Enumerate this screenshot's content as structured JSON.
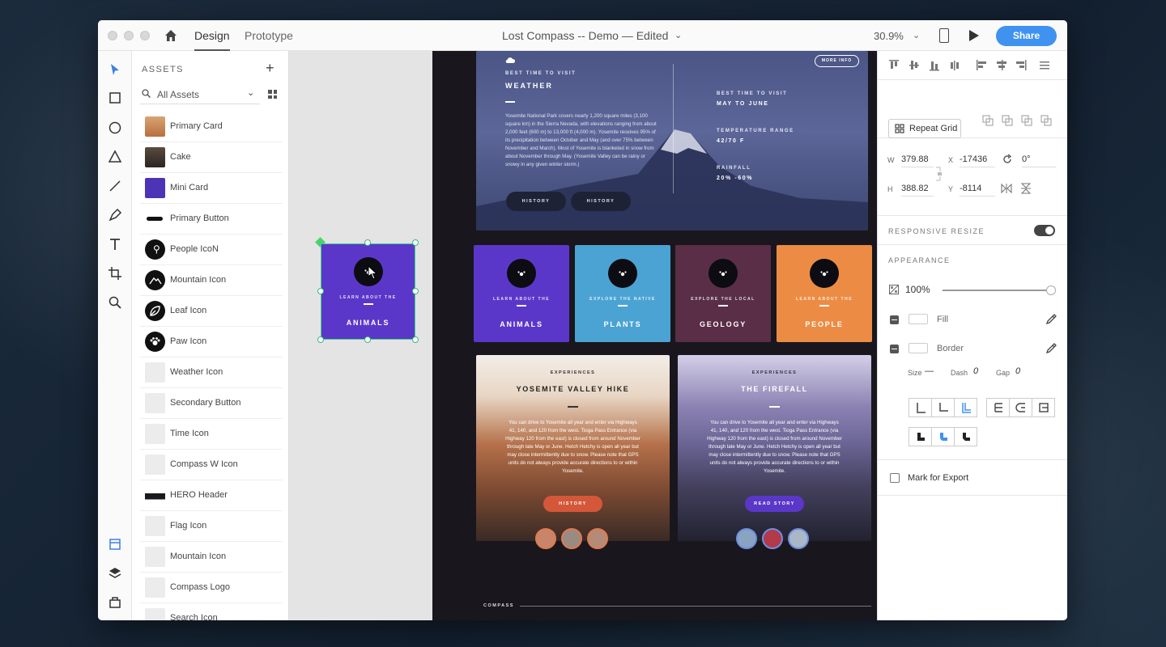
{
  "window": {
    "tabs": [
      {
        "label": "Design"
      },
      {
        "label": "Prototype"
      }
    ],
    "document_title": "Lost Compass -- Demo  —  Edited",
    "zoom": "30.9%",
    "share_label": "Share"
  },
  "assets": {
    "header": "ASSETS",
    "search_placeholder": "All Assets",
    "items": [
      {
        "label": "Primary Card",
        "thumb": "photo-orange"
      },
      {
        "label": "Cake",
        "thumb": "photo-dark"
      },
      {
        "label": "Mini Card",
        "thumb": "purple-card"
      },
      {
        "label": "Primary Button",
        "thumb": "pill-black"
      },
      {
        "label": "People IcoN",
        "thumb": "people-icon"
      },
      {
        "label": "Mountain Icon",
        "thumb": "mountain-icon"
      },
      {
        "label": "Leaf Icon",
        "thumb": "leaf-icon"
      },
      {
        "label": "Paw Icon",
        "thumb": "paw-icon"
      },
      {
        "label": "Weather Icon",
        "thumb": "faded"
      },
      {
        "label": "Secondary Button",
        "thumb": "faded"
      },
      {
        "label": "Time Icon",
        "thumb": "faded"
      },
      {
        "label": "Compass W Icon",
        "thumb": "faded"
      },
      {
        "label": "HERO Header",
        "thumb": "hero-strip"
      },
      {
        "label": "Flag Icon",
        "thumb": "faded"
      },
      {
        "label": "Mountain Icon",
        "thumb": "faded"
      },
      {
        "label": "Compass Logo",
        "thumb": "faded"
      },
      {
        "label": "Search Icon",
        "thumb": "faded"
      }
    ]
  },
  "artboard": {
    "hero": {
      "kicker": "BEST TIME TO VISIT",
      "title": "WEATHER",
      "body": "Yosemite National Park covers nearly 1,200 square miles (3,100 square km) in the Sierra Nevada, with elevations ranging from about 2,000 feet (600 m) to 13,000 ft (4,000 m). Yosemite receives 95% of its precipitation between October and May (and over 75% between November and March). Most of Yosemite is blanketed in snow from about November through May. (Yosemite Valley can be rainy or snowy in any given winter storm.)",
      "btn1": "HISTORY",
      "btn2": "HISTORY",
      "more_info": "MORE INFO",
      "stats": [
        {
          "label": "BEST TIME TO VISIT",
          "value": "MAY TO JUNE"
        },
        {
          "label": "TEMPERATURE RANGE",
          "value": "42/70 F"
        },
        {
          "label": "RAINFALL",
          "value": "20% -60%"
        }
      ]
    },
    "categories": [
      {
        "sub": "LEARN ABOUT THE",
        "title": "ANIMALS",
        "color": "#5b37c9"
      },
      {
        "sub": "EXPLORE THE NATIVE",
        "title": "PLANTS",
        "color": "#4ba3d4"
      },
      {
        "sub": "EXPLORE THE LOCAL",
        "title": "GEOLOGY",
        "color": "#5a2e47"
      },
      {
        "sub": "LEARN ABOUT THE",
        "title": "PEOPLE",
        "color": "#ec8c44"
      }
    ],
    "experiences": [
      {
        "kicker": "EXPERIENCES",
        "title": "YOSEMITE VALLEY HIKE",
        "body": "You can drive to Yosemite all year and enter via Highways 41, 140, and 120 from the west. Tioga Pass Entrance (via Highway 120 from the east) is closed from around November through late May or June. Hetch Hetchy is open all year but may close intermittently due to snow. Please note that GPS units do not always provide accurate directions to or within Yosemite.",
        "button": "HISTORY",
        "button_color": "#d4573a"
      },
      {
        "kicker": "EXPERIENCES",
        "title": "THE FIREFALL",
        "body": "You can drive to Yosemite all year and enter via Highways 41, 140, and 120 from the west. Tioga Pass Entrance (via Highway 120 from the east) is closed from around November through late May or June. Hetch Hetchy is open all year but may close intermittently due to snow. Please note that GPS units do not always provide accurate directions to or within Yosemite.",
        "button": "READ STORY",
        "button_color": "#5b37c9"
      }
    ],
    "footer_logo": "COMPASS"
  },
  "selected_component": {
    "sub": "LEARN ABOUT THE",
    "title": "ANIMALS"
  },
  "properties": {
    "repeat_grid": "Repeat Grid",
    "w_label": "W",
    "w": "379.88",
    "x_label": "X",
    "x": "-17436",
    "rotation": "0°",
    "h_label": "H",
    "h": "388.82",
    "y_label": "Y",
    "y": "-8114",
    "responsive_resize": "RESPONSIVE RESIZE",
    "appearance": "APPEARANCE",
    "opacity": "100%",
    "opacity_fraction": 1.0,
    "fill": "Fill",
    "border": "Border",
    "size_label": "Size",
    "size": "—",
    "dash_label": "Dash",
    "dash": "0",
    "gap_label": "Gap",
    "gap": "0",
    "mark_export": "Mark for Export"
  }
}
